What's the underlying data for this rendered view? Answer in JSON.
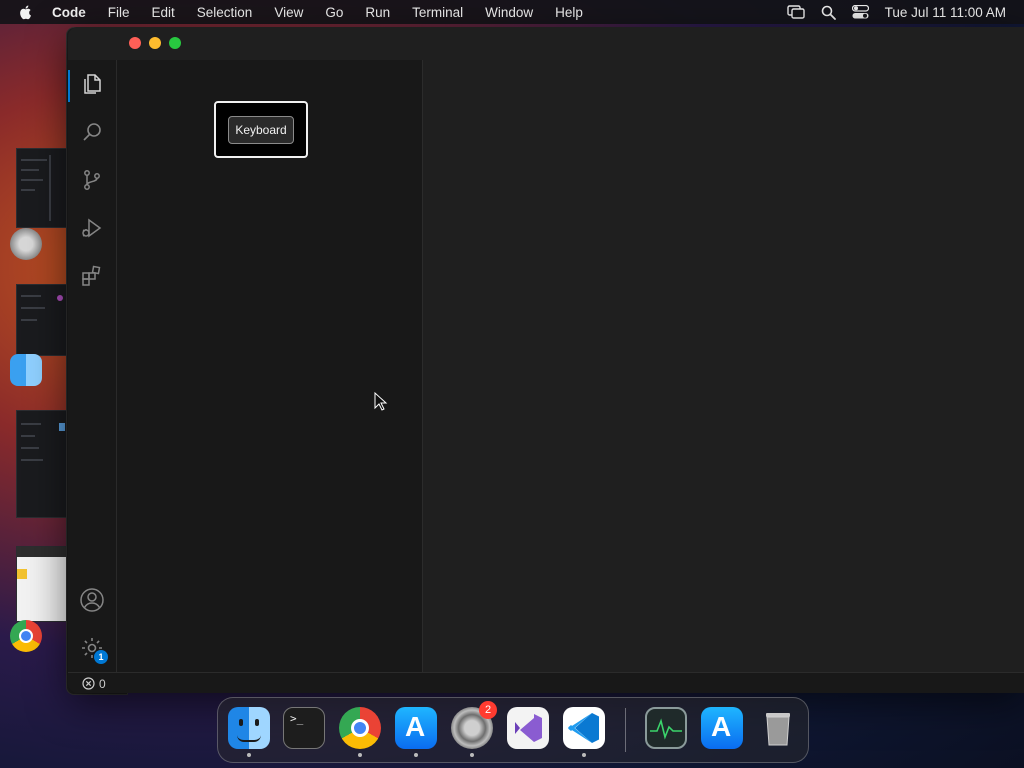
{
  "menubar": {
    "app_name": "Code",
    "items": [
      "File",
      "Edit",
      "Selection",
      "View",
      "Go",
      "Run",
      "Terminal",
      "Window",
      "Help"
    ],
    "clock": "Tue Jul 11  11:00 AM"
  },
  "activity_bar": {
    "items": [
      "explorer-icon",
      "search-icon",
      "source-control-icon",
      "run-debug-icon",
      "extensions-icon"
    ],
    "manage_badge": "1",
    "accent_color": "#0078d4"
  },
  "tooltip": {
    "label": "Keyboard"
  },
  "statusbar": {
    "errors": "0"
  },
  "dock": {
    "apps": [
      "Finder",
      "Terminal",
      "Google Chrome",
      "App Store",
      "System Settings",
      "Visual Studio",
      "Visual Studio Code",
      "Activity Monitor",
      "App Store",
      "Trash"
    ],
    "system_settings_badge": "2"
  }
}
